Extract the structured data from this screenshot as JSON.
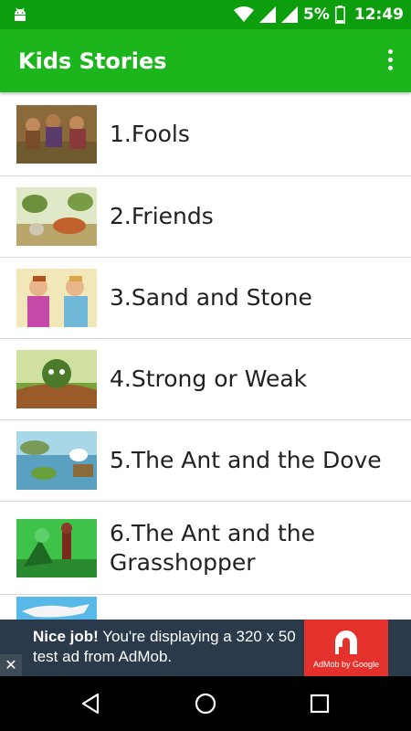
{
  "status_bar": {
    "battery_percent": "5%",
    "time": "12:49",
    "icons": [
      "android-icon",
      "wifi-icon",
      "signal-icon",
      "signal-icon-2",
      "battery-icon"
    ]
  },
  "app_bar": {
    "title": "Kids Stories",
    "menu_icon": "overflow-menu-icon"
  },
  "stories": [
    {
      "label": "1.Fools"
    },
    {
      "label": "2.Friends"
    },
    {
      "label": "3.Sand and Stone"
    },
    {
      "label": "4.Strong or Weak"
    },
    {
      "label": "5.The Ant and the Dove"
    },
    {
      "label": "6.The Ant and the Grasshopper"
    },
    {
      "label": ""
    }
  ],
  "ad_banner": {
    "headline": "Nice job!",
    "body": " You're displaying a 320 x 50 test ad from AdMob.",
    "brand_caption": "AdMob by Google",
    "close_label": "✕",
    "brand_color": "#e5312c"
  },
  "colors": {
    "status_bar": "#0d9e0d",
    "app_bar": "#1cb51c",
    "ad_background": "#2a3a4a"
  },
  "nav_bar": {
    "icons": [
      "back-icon",
      "home-icon",
      "recents-icon"
    ]
  }
}
